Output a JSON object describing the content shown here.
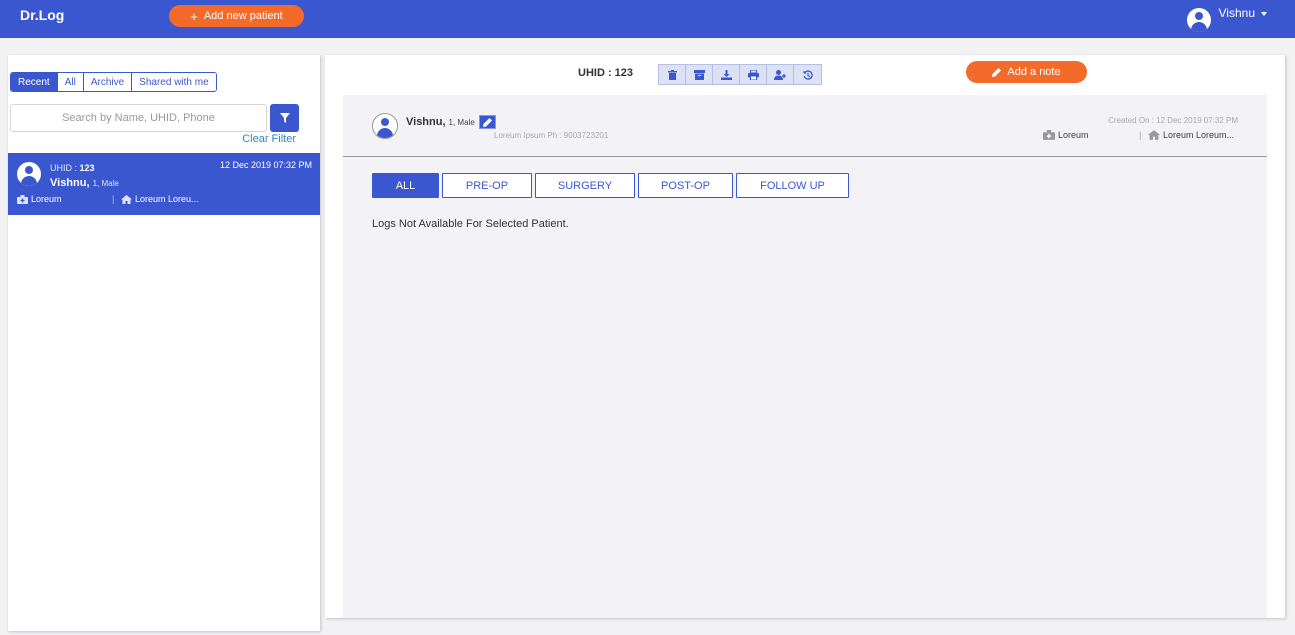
{
  "header": {
    "brand": "Dr.Log",
    "add_patient_label": "Add new patient",
    "add_patient_icon": "plus-icon",
    "user_name": "Vishnu",
    "colors": {
      "primary": "#3b57cf",
      "accent": "#f36b2b"
    }
  },
  "sidebar": {
    "tabs": [
      {
        "label": "Recent",
        "active": true
      },
      {
        "label": "All",
        "active": false
      },
      {
        "label": "Archive",
        "active": false
      },
      {
        "label": "Shared with me",
        "active": false
      }
    ],
    "search": {
      "placeholder": "Search by Name, UHID, Phone",
      "value": ""
    },
    "clear_filter_label": "Clear Filter",
    "patients": [
      {
        "uhid_label": "UHID : ",
        "uhid": "123",
        "date": "12 Dec 2019 07:32 PM",
        "name": "Vishnu",
        "meta": "1, Male",
        "hospital": "Loreum",
        "address": "Loreum Loreu..."
      }
    ]
  },
  "detail": {
    "uhid_title": "UHID : 123",
    "toolbar_icons": [
      "trash-icon",
      "archive-icon",
      "download-icon",
      "print-icon",
      "share-user-icon",
      "history-icon"
    ],
    "add_note_label": "Add a note",
    "patient": {
      "name": "Vishnu,",
      "meta": "1, Male",
      "phone_line": "Loreum Ipsum Ph : 9003723201",
      "created_on": "Created On : 12 Dec 2019 07:32 PM",
      "hospital": "Loreum",
      "address": "Loreum Loreum..."
    },
    "stage_tabs": [
      {
        "label": "ALL",
        "active": true
      },
      {
        "label": "PRE-OP",
        "active": false
      },
      {
        "label": "SURGERY",
        "active": false
      },
      {
        "label": "POST-OP",
        "active": false
      },
      {
        "label": "FOLLOW UP",
        "active": false
      }
    ],
    "empty_message": "Logs Not Available For Selected Patient."
  }
}
